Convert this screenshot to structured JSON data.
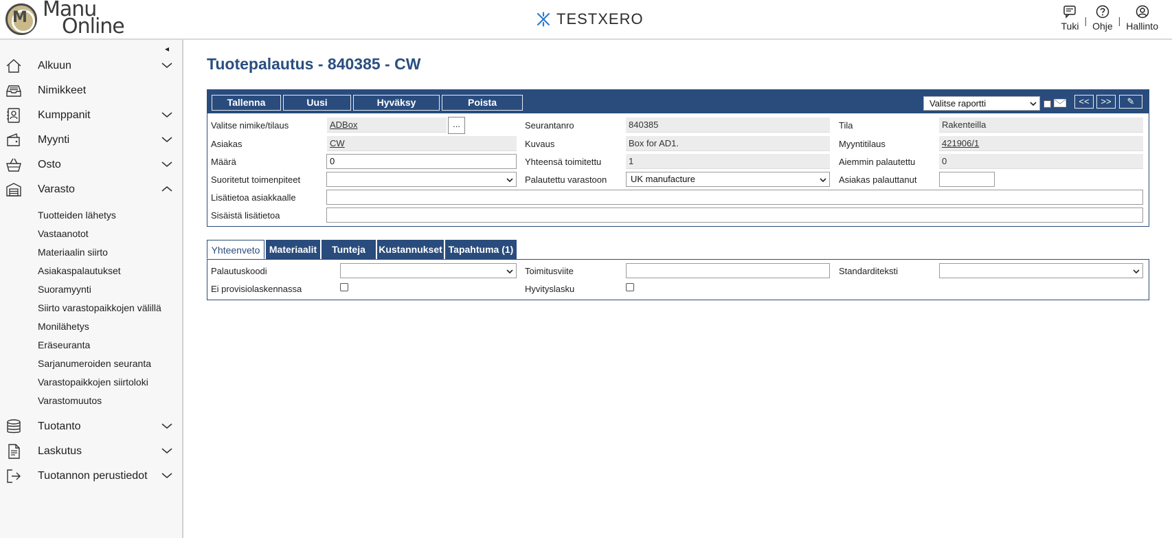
{
  "header": {
    "brand": "TESTXERO",
    "links": [
      {
        "label": "Tuki",
        "icon": "chat-icon"
      },
      {
        "label": "Ohje",
        "icon": "help-icon"
      },
      {
        "label": "Hallinto",
        "icon": "user-icon"
      }
    ],
    "separator": "|"
  },
  "logo": {
    "line1": "Manu",
    "line2": "Online",
    "mark": "M"
  },
  "sidebar": {
    "collapse": "◂",
    "items": [
      {
        "label": "Alkuun",
        "icon": "home-icon",
        "expandable": true
      },
      {
        "label": "Nimikkeet",
        "icon": "inbox-icon",
        "expandable": false
      },
      {
        "label": "Kumppanit",
        "icon": "contacts-icon",
        "expandable": true
      },
      {
        "label": "Myynti",
        "icon": "wallet-icon",
        "expandable": true
      },
      {
        "label": "Osto",
        "icon": "basket-icon",
        "expandable": true
      },
      {
        "label": "Varasto",
        "icon": "warehouse-icon",
        "expandable": true,
        "expanded": true
      }
    ],
    "varasto_sub": [
      "Tuotteiden lähetys",
      "Vastaanotot",
      "Materiaalin siirto",
      "Asiakaspalautukset",
      "Suoramyynti",
      "Siirto varastopaikkojen välillä",
      "Monilähetys",
      "Eräseuranta",
      "Sarjanumeroiden seuranta",
      "Varastopaikkojen siirtoloki",
      "Varastomuutos"
    ],
    "items_after": [
      {
        "label": "Tuotanto",
        "icon": "database-icon"
      },
      {
        "label": "Laskutus",
        "icon": "document-icon"
      },
      {
        "label": "Tuotannon perustiedot",
        "icon": "exit-icon"
      }
    ]
  },
  "page": {
    "title": "Tuotepalautus - 840385 - CW"
  },
  "toolbar": {
    "buttons": [
      "Tallenna",
      "Uusi",
      "Hyväksy",
      "Poista"
    ],
    "report_select": "Valitse raportti",
    "prev": "<<",
    "next": ">>",
    "attach": "✎"
  },
  "form": {
    "labels": {
      "item_order": "Valitse nimike/tilaus",
      "tracking_no": "Seurantanro",
      "state": "Tila",
      "customer": "Asiakas",
      "description": "Kuvaus",
      "sales_order": "Myyntitilaus",
      "quantity": "Määrä",
      "total_delivered": "Yhteensä toimitettu",
      "previously_returned": "Aiemmin palautettu",
      "actions": "Suoritetut toimenpiteet",
      "returned_to": "Palautettu varastoon",
      "customer_returned": "Asiakas palauttanut",
      "info_customer": "Lisätietoa asiakkaalle",
      "info_internal": "Sisäistä lisätietoa"
    },
    "values": {
      "item_order": "ADBox",
      "dots": "...",
      "tracking_no": "840385",
      "state": "Rakenteilla",
      "customer": "CW",
      "description": "Box for AD1.",
      "sales_order": "421906/1",
      "quantity": "0",
      "total_delivered": "1",
      "previously_returned": "0",
      "actions": "",
      "returned_to": "UK manufacture",
      "customer_returned": "",
      "info_customer": "",
      "info_internal": ""
    }
  },
  "tabs": [
    {
      "label": "Yhteenveto",
      "active": true
    },
    {
      "label": "Materiaalit",
      "active": false
    },
    {
      "label": "Tunteja",
      "active": false
    },
    {
      "label": "Kustannukset",
      "active": false
    },
    {
      "label": "Tapahtuma (1)",
      "active": false
    }
  ],
  "summary": {
    "labels": {
      "return_code": "Palautuskoodi",
      "delivery_ref": "Toimitusviite",
      "standard_text": "Standarditeksti",
      "no_commission": "Ei provisiolaskennassa",
      "credit_invoice": "Hyvityslasku"
    },
    "values": {
      "return_code": "",
      "delivery_ref": "",
      "standard_text": "",
      "no_commission": false,
      "credit_invoice": false
    }
  }
}
